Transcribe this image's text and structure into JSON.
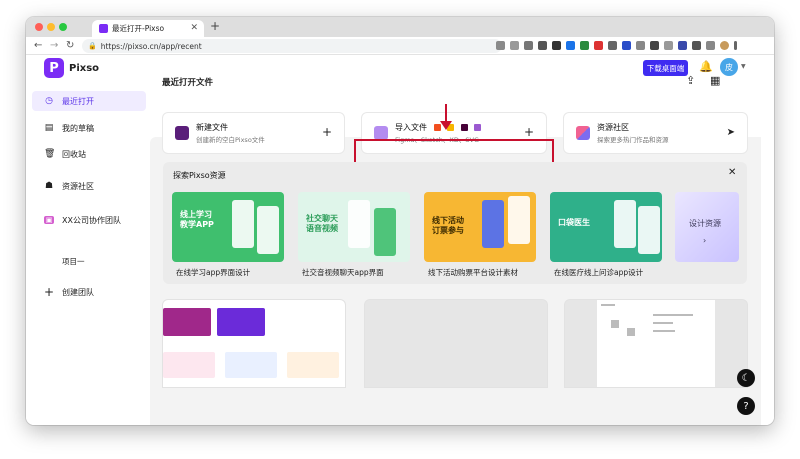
{
  "browser": {
    "tab_title": "最近打开-Pixso",
    "url": "https://pixso.cn/app/recent"
  },
  "app": {
    "logo_letter": "P",
    "logo_name": "Pixso",
    "download_button": "下载桌面端",
    "avatar_text": "皮"
  },
  "sidebar": {
    "items": [
      {
        "label": "最近打开"
      },
      {
        "label": "我的草稿"
      },
      {
        "label": "回收站"
      },
      {
        "label": "资源社区"
      },
      {
        "label": "XX公司协作团队"
      },
      {
        "label": "项目一"
      },
      {
        "label": "创建团队"
      }
    ]
  },
  "page": {
    "title": "最近打开文件"
  },
  "quick_actions": [
    {
      "title": "新建文件",
      "subtitle": "创建新的空白Pixso文件",
      "action": "+"
    },
    {
      "title": "导入文件",
      "subtitle": "Figma、Sketch、XD、SVG",
      "action": "+"
    },
    {
      "title": "资源社区",
      "subtitle": "探索更多热门作品和资源",
      "action": "➤"
    }
  ],
  "explore": {
    "title": "探索Pixso资源",
    "resources": [
      {
        "thumb_text": "线上学习\n教学APP",
        "label": "在线学习app界面设计"
      },
      {
        "thumb_text": "社交聊天\n语音视频",
        "label": "社交音视频聊天app界面"
      },
      {
        "thumb_text": "线下活动\n订票参与",
        "label": "线下活动购票平台设计素材"
      },
      {
        "thumb_text": "口袋医生",
        "label": "在线医疗线上问诊app设计"
      }
    ],
    "design_resources_label": "设计资源"
  },
  "colors": {
    "brand": "#7b2cf5",
    "download_btn": "#3f2cf1",
    "highlight": "#c8102e"
  }
}
